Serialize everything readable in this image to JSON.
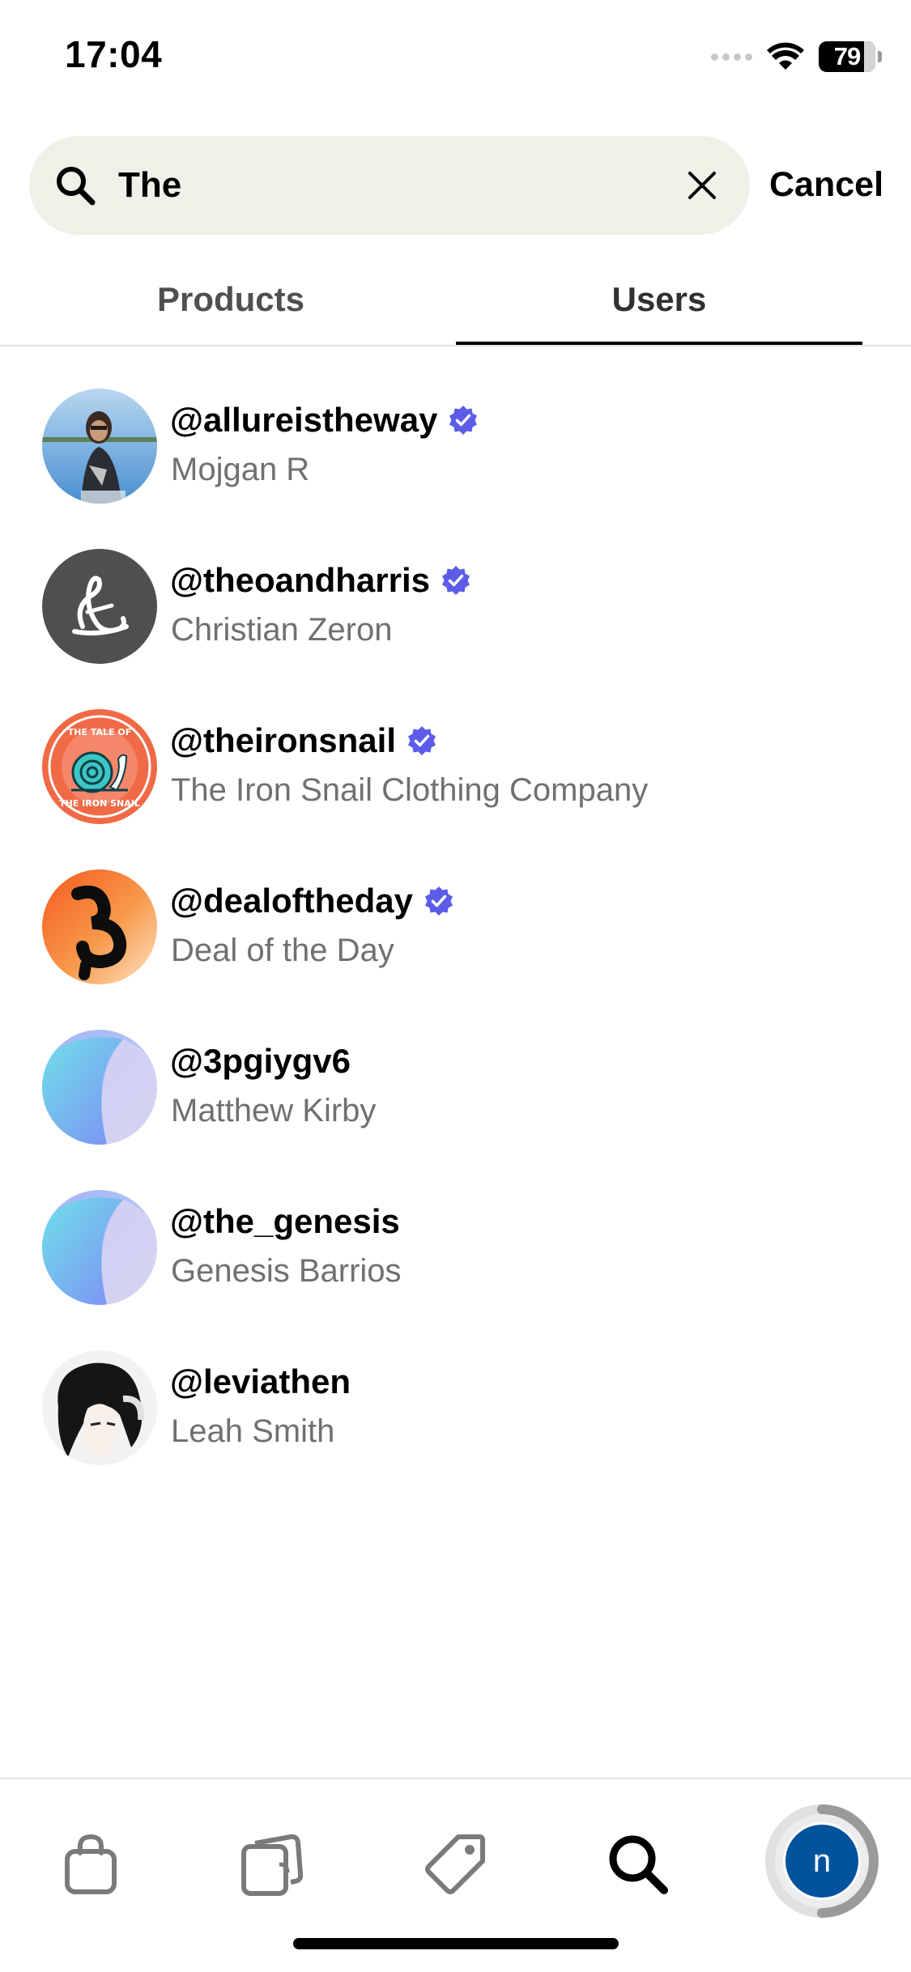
{
  "status_bar": {
    "time": "17:04",
    "battery_percent": "79",
    "icons": [
      "cellular-signal-icon",
      "wifi-icon",
      "battery-icon"
    ]
  },
  "search": {
    "query": "The",
    "icon": "search-icon",
    "clear_icon": "close-icon",
    "cancel_label": "Cancel"
  },
  "tabs": [
    {
      "label": "Products",
      "selected": false
    },
    {
      "label": "Users",
      "selected": true
    }
  ],
  "users": [
    {
      "handle": "@allureistheway",
      "name": "Mojgan R",
      "verified": true,
      "avatar": "photo-woman-lake"
    },
    {
      "handle": "@theoandharris",
      "name": "Christian Zeron",
      "verified": true,
      "avatar": "logo-signature"
    },
    {
      "handle": "@theironsnail",
      "name": "The Iron Snail Clothing Company",
      "verified": true,
      "avatar": "logo-snail",
      "avatar_text_top": "THE TALE OF",
      "avatar_text_bottom": "THE IRON SNAIL"
    },
    {
      "handle": "@dealoftheday",
      "name": "Deal of the Day",
      "verified": true,
      "avatar": "logo-deal"
    },
    {
      "handle": "@3pgiygv6",
      "name": "Matthew Kirby",
      "verified": false,
      "avatar": "default-gradient"
    },
    {
      "handle": "@the_genesis",
      "name": "Genesis Barrios",
      "verified": false,
      "avatar": "default-gradient"
    },
    {
      "handle": "@leviathen",
      "name": "Leah Smith",
      "verified": false,
      "avatar": "illustration-anime"
    }
  ],
  "colors": {
    "verified_badge": "#5c5ce8",
    "search_bg": "#f1f0e8",
    "profile_avatar": "#00539c"
  },
  "bottom_nav": {
    "items": [
      {
        "icon": "shopping-bag-icon",
        "active": false
      },
      {
        "icon": "cards-icon",
        "active": false
      },
      {
        "icon": "tag-icon",
        "active": false
      },
      {
        "icon": "search-icon",
        "active": true
      }
    ],
    "profile_initial": "n"
  }
}
